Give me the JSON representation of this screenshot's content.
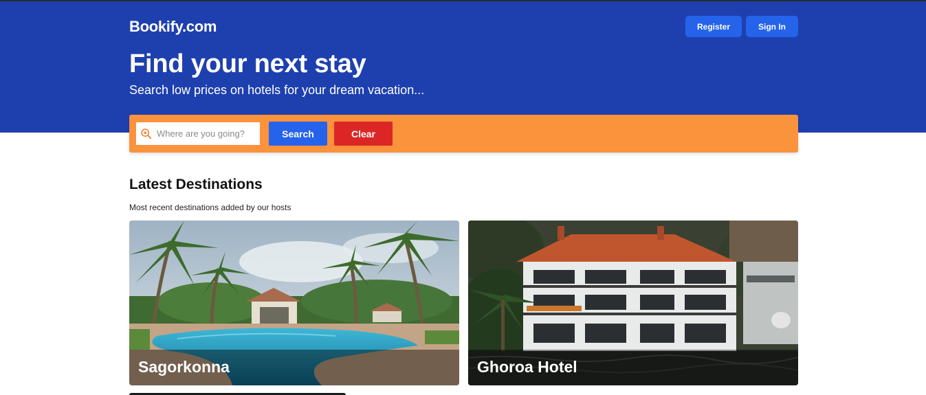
{
  "header": {
    "logo": "Bookify.com",
    "register_label": "Register",
    "signin_label": "Sign In",
    "headline": "Find your next stay",
    "subheadline": "Search low prices on hotels for your dream vacation..."
  },
  "search": {
    "placeholder": "Where are you going?",
    "value": "",
    "search_label": "Search",
    "clear_label": "Clear",
    "icon": "location-search-icon"
  },
  "latest": {
    "title": "Latest Destinations",
    "subtitle": "Most recent destinations added by our hosts",
    "cards": [
      {
        "name": "Sagorkonna"
      },
      {
        "name": "Ghoroa Hotel"
      }
    ]
  },
  "colors": {
    "header_bg": "#1e40af",
    "primary_button": "#2563eb",
    "search_bar": "#fb923c",
    "clear_button": "#dc2626"
  }
}
